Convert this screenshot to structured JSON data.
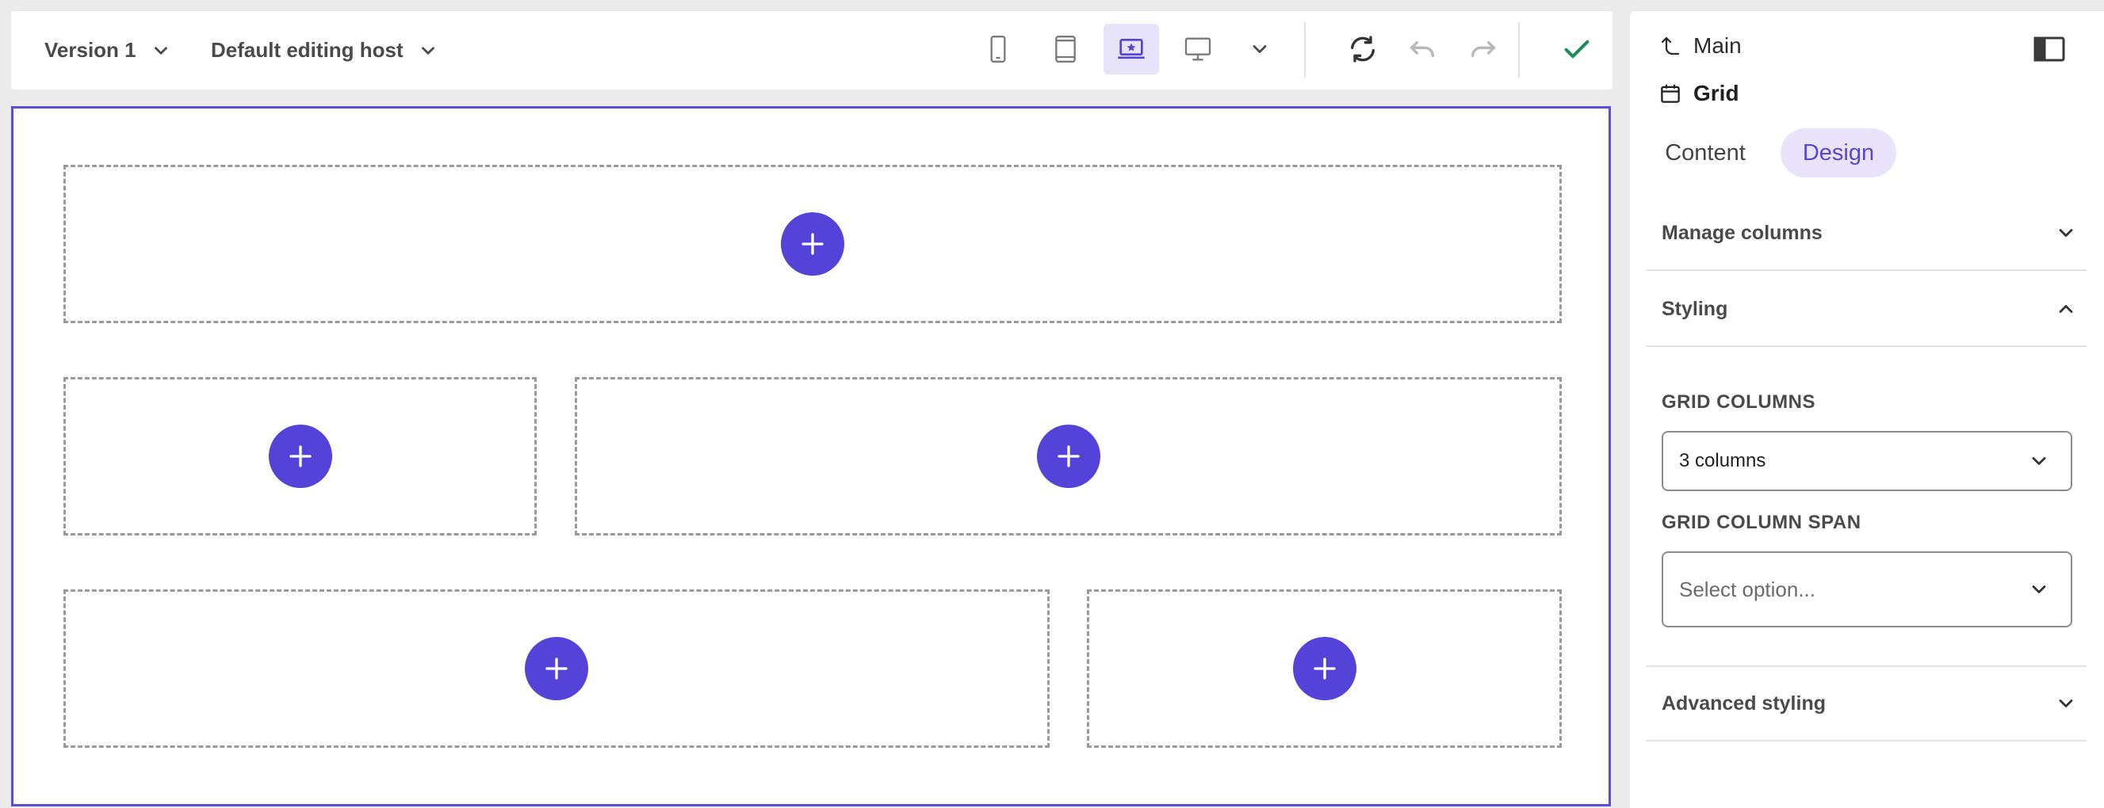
{
  "toolbar": {
    "version_label": "Version 1",
    "host_label": "Default editing host",
    "devices": [
      {
        "name": "phone-icon"
      },
      {
        "name": "tablet-icon"
      },
      {
        "name": "laptop-icon",
        "active": true
      },
      {
        "name": "desktop-icon"
      }
    ],
    "icons": [
      "chevron-down-icon",
      "refresh-icon",
      "undo-icon",
      "redo-icon",
      "check-icon"
    ],
    "colors": {
      "accent": "#5443d8",
      "check": "#1f8a5b",
      "disabled": "#b8b8b8"
    }
  },
  "canvas": {
    "slots": [
      {
        "row": 1,
        "add_icon": "plus-icon"
      },
      {
        "row": 2,
        "add_icon": "plus-icon"
      },
      {
        "row": 2,
        "add_icon": "plus-icon"
      },
      {
        "row": 3,
        "add_icon": "plus-icon"
      },
      {
        "row": 3,
        "add_icon": "plus-icon"
      }
    ]
  },
  "panel": {
    "breadcrumb_parent": "Main",
    "breadcrumb_current": "Grid",
    "tabs": [
      {
        "label": "Content",
        "active": false
      },
      {
        "label": "Design",
        "active": true
      }
    ],
    "sections": {
      "manage_columns": "Manage columns",
      "styling": "Styling",
      "advanced_styling": "Advanced styling"
    },
    "grid_columns": {
      "label": "GRID COLUMNS",
      "value": "3 columns"
    },
    "grid_column_span": {
      "label": "GRID COLUMN SPAN",
      "placeholder": "Select option..."
    }
  }
}
